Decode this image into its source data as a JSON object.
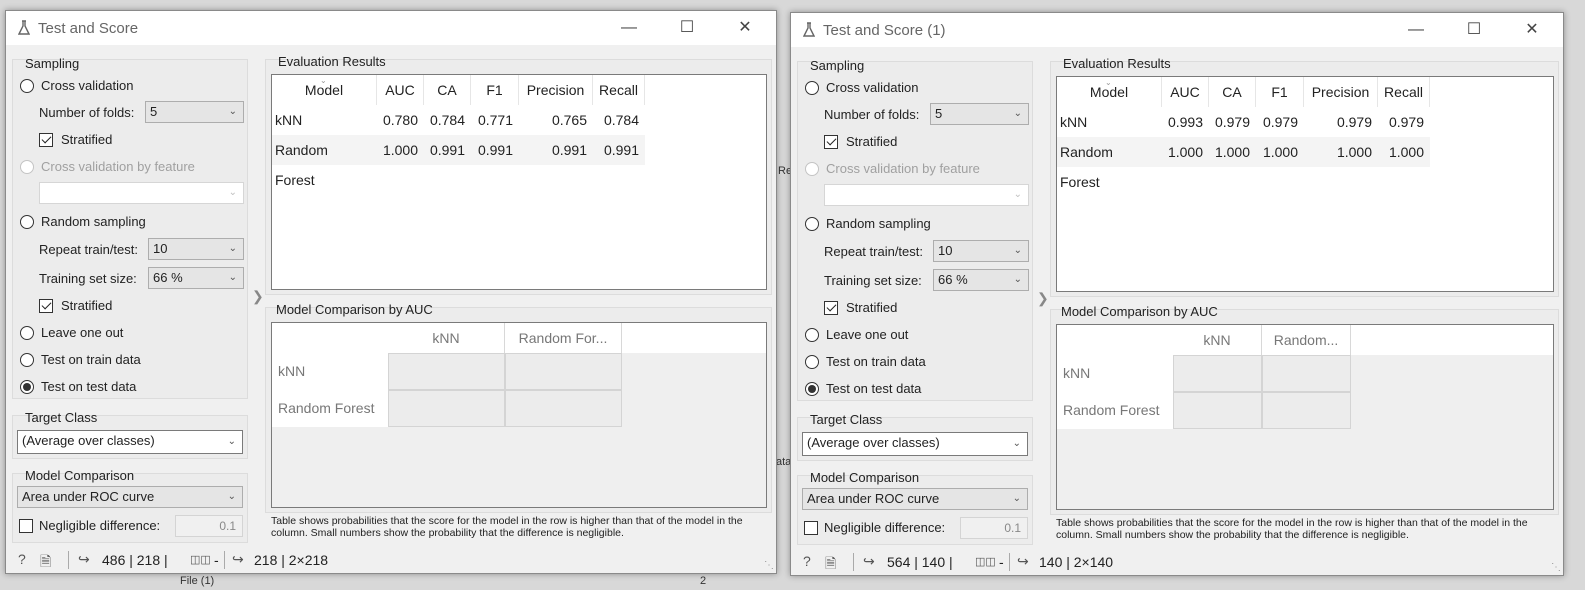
{
  "background": {
    "fragments": [
      "Re",
      "ata",
      "File (1)",
      "2"
    ]
  },
  "windows": [
    {
      "title": "Test and Score",
      "sampling": {
        "title": "Sampling",
        "cross_validation": "Cross validation",
        "folds_label": "Number of folds:",
        "folds_value": "5",
        "stratified_label": "Stratified",
        "cv_by_feature": "Cross validation by feature",
        "feature_value": "",
        "random_sampling": "Random sampling",
        "repeat_label": "Repeat train/test:",
        "repeat_value": "10",
        "train_size_label": "Training set size:",
        "train_size_value": "66 %",
        "stratified2_label": "Stratified",
        "leave_one_out": "Leave one out",
        "test_on_train": "Test on train data",
        "test_on_test": "Test on test data",
        "selected": "test_on_test"
      },
      "target_class": {
        "title": "Target Class",
        "value": "(Average over classes)"
      },
      "model_comparison": {
        "title": "Model Comparison",
        "value": "Area under ROC curve",
        "negligible_label": "Negligible difference:",
        "negligible_value": "0.1"
      },
      "evaluation": {
        "title": "Evaluation Results",
        "columns": [
          "Model",
          "AUC",
          "CA",
          "F1",
          "Precision",
          "Recall"
        ],
        "rows": [
          [
            "kNN",
            "0.780",
            "0.784",
            "0.771",
            "0.765",
            "0.784"
          ],
          [
            "Random Forest",
            "1.000",
            "0.991",
            "0.991",
            "0.991",
            "0.991"
          ]
        ]
      },
      "comparison": {
        "title": "Model Comparison by AUC",
        "col_headers": [
          "kNN",
          "Random For..."
        ],
        "row_headers": [
          "kNN",
          "Random Forest"
        ]
      },
      "note": "Table shows probabilities that the score for the model in the row is higher than that of the model in the column. Small numbers show the probability that the difference is negligible.",
      "status": {
        "input": "486 | 218 | ",
        "input_dash": "-",
        "output": "218 | 2×218"
      }
    },
    {
      "title": "Test and Score (1)",
      "sampling": {
        "title": "Sampling",
        "cross_validation": "Cross validation",
        "folds_label": "Number of folds:",
        "folds_value": "5",
        "stratified_label": "Stratified",
        "cv_by_feature": "Cross validation by feature",
        "feature_value": "",
        "random_sampling": "Random sampling",
        "repeat_label": "Repeat train/test:",
        "repeat_value": "10",
        "train_size_label": "Training set size:",
        "train_size_value": "66 %",
        "stratified2_label": "Stratified",
        "leave_one_out": "Leave one out",
        "test_on_train": "Test on train data",
        "test_on_test": "Test on test data",
        "selected": "test_on_test"
      },
      "target_class": {
        "title": "Target Class",
        "value": "(Average over classes)"
      },
      "model_comparison": {
        "title": "Model Comparison",
        "value": "Area under ROC curve",
        "negligible_label": "Negligible difference:",
        "negligible_value": "0.1"
      },
      "evaluation": {
        "title": "Evaluation Results",
        "columns": [
          "Model",
          "AUC",
          "CA",
          "F1",
          "Precision",
          "Recall"
        ],
        "rows": [
          [
            "kNN",
            "0.993",
            "0.979",
            "0.979",
            "0.979",
            "0.979"
          ],
          [
            "Random Forest",
            "1.000",
            "1.000",
            "1.000",
            "1.000",
            "1.000"
          ]
        ]
      },
      "comparison": {
        "title": "Model Comparison by AUC",
        "col_headers": [
          "kNN",
          "Random..."
        ],
        "row_headers": [
          "kNN",
          "Random Forest"
        ]
      },
      "note": "Table shows probabilities that the score for the model in the row is higher than that of the model in the column. Small numbers show the probability that the difference is negligible.",
      "status": {
        "input": "564 | 140 | ",
        "input_dash": "-",
        "output": "140 | 2×140"
      }
    }
  ]
}
